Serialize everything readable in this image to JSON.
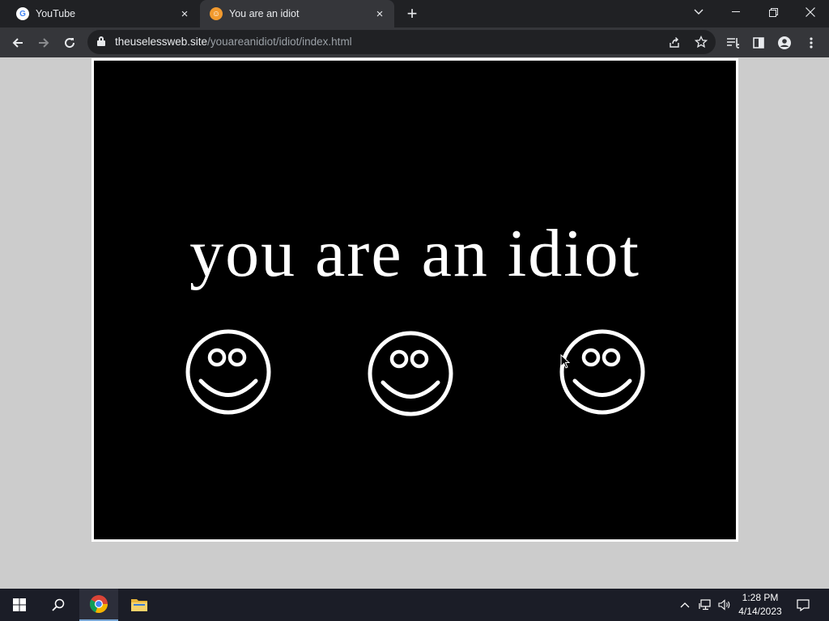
{
  "browser": {
    "tabs": [
      {
        "title": "YouTube",
        "favicon": "google-g-icon",
        "active": false
      },
      {
        "title": "You are an idiot",
        "favicon": "idiot-site-icon",
        "active": true
      }
    ],
    "close_glyph": "×",
    "new_tab_glyph": "+",
    "url_host": "theuselessweb.site",
    "url_path": "/youareanidiot/idiot/index.html"
  },
  "page": {
    "headline": "you are an idiot",
    "smiley_count": 3,
    "colors": {
      "stage_bg": "#000000",
      "stage_border": "#ffffff",
      "text": "#ffffff",
      "page_bg": "#cccccc"
    }
  },
  "taskbar": {
    "time": "1:28 PM",
    "date": "4/14/2023"
  },
  "colors": {
    "chrome_dark": "#202124",
    "chrome_toolbar": "#35363a",
    "taskbar": "#1b1d27"
  }
}
